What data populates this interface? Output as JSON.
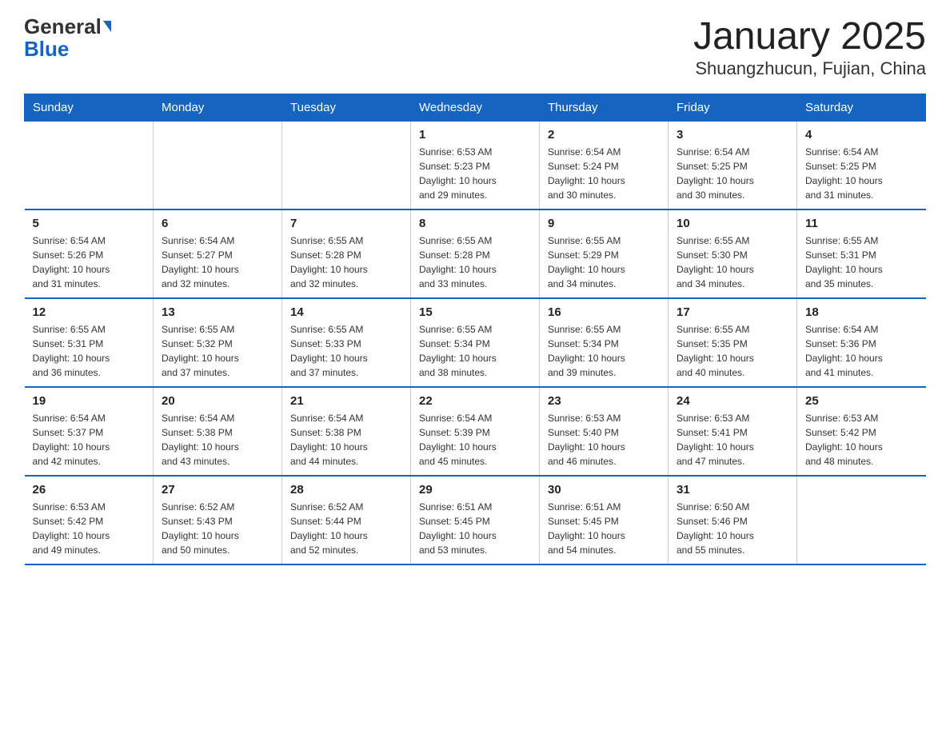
{
  "header": {
    "logo_main": "General",
    "logo_sub": "Blue",
    "title": "January 2025",
    "subtitle": "Shuangzhucun, Fujian, China"
  },
  "days_of_week": [
    "Sunday",
    "Monday",
    "Tuesday",
    "Wednesday",
    "Thursday",
    "Friday",
    "Saturday"
  ],
  "weeks": [
    [
      {
        "day": "",
        "info": ""
      },
      {
        "day": "",
        "info": ""
      },
      {
        "day": "",
        "info": ""
      },
      {
        "day": "1",
        "info": "Sunrise: 6:53 AM\nSunset: 5:23 PM\nDaylight: 10 hours\nand 29 minutes."
      },
      {
        "day": "2",
        "info": "Sunrise: 6:54 AM\nSunset: 5:24 PM\nDaylight: 10 hours\nand 30 minutes."
      },
      {
        "day": "3",
        "info": "Sunrise: 6:54 AM\nSunset: 5:25 PM\nDaylight: 10 hours\nand 30 minutes."
      },
      {
        "day": "4",
        "info": "Sunrise: 6:54 AM\nSunset: 5:25 PM\nDaylight: 10 hours\nand 31 minutes."
      }
    ],
    [
      {
        "day": "5",
        "info": "Sunrise: 6:54 AM\nSunset: 5:26 PM\nDaylight: 10 hours\nand 31 minutes."
      },
      {
        "day": "6",
        "info": "Sunrise: 6:54 AM\nSunset: 5:27 PM\nDaylight: 10 hours\nand 32 minutes."
      },
      {
        "day": "7",
        "info": "Sunrise: 6:55 AM\nSunset: 5:28 PM\nDaylight: 10 hours\nand 32 minutes."
      },
      {
        "day": "8",
        "info": "Sunrise: 6:55 AM\nSunset: 5:28 PM\nDaylight: 10 hours\nand 33 minutes."
      },
      {
        "day": "9",
        "info": "Sunrise: 6:55 AM\nSunset: 5:29 PM\nDaylight: 10 hours\nand 34 minutes."
      },
      {
        "day": "10",
        "info": "Sunrise: 6:55 AM\nSunset: 5:30 PM\nDaylight: 10 hours\nand 34 minutes."
      },
      {
        "day": "11",
        "info": "Sunrise: 6:55 AM\nSunset: 5:31 PM\nDaylight: 10 hours\nand 35 minutes."
      }
    ],
    [
      {
        "day": "12",
        "info": "Sunrise: 6:55 AM\nSunset: 5:31 PM\nDaylight: 10 hours\nand 36 minutes."
      },
      {
        "day": "13",
        "info": "Sunrise: 6:55 AM\nSunset: 5:32 PM\nDaylight: 10 hours\nand 37 minutes."
      },
      {
        "day": "14",
        "info": "Sunrise: 6:55 AM\nSunset: 5:33 PM\nDaylight: 10 hours\nand 37 minutes."
      },
      {
        "day": "15",
        "info": "Sunrise: 6:55 AM\nSunset: 5:34 PM\nDaylight: 10 hours\nand 38 minutes."
      },
      {
        "day": "16",
        "info": "Sunrise: 6:55 AM\nSunset: 5:34 PM\nDaylight: 10 hours\nand 39 minutes."
      },
      {
        "day": "17",
        "info": "Sunrise: 6:55 AM\nSunset: 5:35 PM\nDaylight: 10 hours\nand 40 minutes."
      },
      {
        "day": "18",
        "info": "Sunrise: 6:54 AM\nSunset: 5:36 PM\nDaylight: 10 hours\nand 41 minutes."
      }
    ],
    [
      {
        "day": "19",
        "info": "Sunrise: 6:54 AM\nSunset: 5:37 PM\nDaylight: 10 hours\nand 42 minutes."
      },
      {
        "day": "20",
        "info": "Sunrise: 6:54 AM\nSunset: 5:38 PM\nDaylight: 10 hours\nand 43 minutes."
      },
      {
        "day": "21",
        "info": "Sunrise: 6:54 AM\nSunset: 5:38 PM\nDaylight: 10 hours\nand 44 minutes."
      },
      {
        "day": "22",
        "info": "Sunrise: 6:54 AM\nSunset: 5:39 PM\nDaylight: 10 hours\nand 45 minutes."
      },
      {
        "day": "23",
        "info": "Sunrise: 6:53 AM\nSunset: 5:40 PM\nDaylight: 10 hours\nand 46 minutes."
      },
      {
        "day": "24",
        "info": "Sunrise: 6:53 AM\nSunset: 5:41 PM\nDaylight: 10 hours\nand 47 minutes."
      },
      {
        "day": "25",
        "info": "Sunrise: 6:53 AM\nSunset: 5:42 PM\nDaylight: 10 hours\nand 48 minutes."
      }
    ],
    [
      {
        "day": "26",
        "info": "Sunrise: 6:53 AM\nSunset: 5:42 PM\nDaylight: 10 hours\nand 49 minutes."
      },
      {
        "day": "27",
        "info": "Sunrise: 6:52 AM\nSunset: 5:43 PM\nDaylight: 10 hours\nand 50 minutes."
      },
      {
        "day": "28",
        "info": "Sunrise: 6:52 AM\nSunset: 5:44 PM\nDaylight: 10 hours\nand 52 minutes."
      },
      {
        "day": "29",
        "info": "Sunrise: 6:51 AM\nSunset: 5:45 PM\nDaylight: 10 hours\nand 53 minutes."
      },
      {
        "day": "30",
        "info": "Sunrise: 6:51 AM\nSunset: 5:45 PM\nDaylight: 10 hours\nand 54 minutes."
      },
      {
        "day": "31",
        "info": "Sunrise: 6:50 AM\nSunset: 5:46 PM\nDaylight: 10 hours\nand 55 minutes."
      },
      {
        "day": "",
        "info": ""
      }
    ]
  ]
}
